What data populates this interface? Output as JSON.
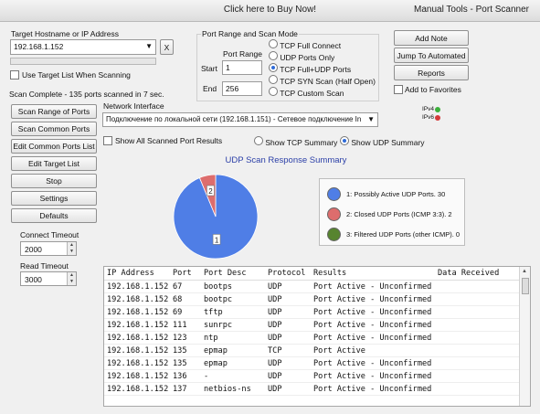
{
  "title": {
    "buy": "Click here to Buy Now!",
    "right": "Manual Tools - Port Scanner"
  },
  "target": {
    "label": "Target Hostname or IP Address",
    "value": "192.168.1.152",
    "clear_label": "X",
    "use_target_list_label": "Use Target List When Scanning"
  },
  "status_text": "Scan Complete - 135 ports scanned in 7 sec.",
  "port_range": {
    "group_label": "Port Range and Scan Mode",
    "section_label": "Port Range",
    "start_label": "Start",
    "start_value": "1",
    "end_label": "End",
    "end_value": "256"
  },
  "scan_modes": [
    {
      "label": "TCP Full Connect",
      "selected": false
    },
    {
      "label": "UDP Ports Only",
      "selected": false
    },
    {
      "label": "TCP Full+UDP Ports",
      "selected": true
    },
    {
      "label": "TCP SYN Scan (Half Open)",
      "selected": false
    },
    {
      "label": "TCP Custom Scan",
      "selected": false
    }
  ],
  "right_buttons": {
    "add_note": "Add Note",
    "jump": "Jump To Automated",
    "reports": "Reports",
    "favorites_label": "Add to Favorites"
  },
  "ip_status": {
    "ipv4": "IPv4",
    "ipv6": "IPv6",
    "ipv4_color": "#3bb03b",
    "ipv6_color": "#d43a3a"
  },
  "network": {
    "label": "Network Interface",
    "value": "Подключение по локальной сети (192.168.1.151) - Сетевое подключение In"
  },
  "filters": {
    "show_all": "Show All Scanned Port Results",
    "show_tcp": "Show TCP Summary",
    "show_udp": "Show UDP Summary"
  },
  "side_buttons": {
    "scan_range": "Scan Range of Ports",
    "scan_common": "Scan Common Ports",
    "edit_common": "Edit Common Ports List",
    "edit_target": "Edit Target List",
    "stop": "Stop",
    "settings": "Settings",
    "defaults": "Defaults"
  },
  "timeouts": {
    "connect_label": "Connect Timeout",
    "connect_value": "2000",
    "read_label": "Read Timeout",
    "read_value": "3000"
  },
  "chart_data": {
    "type": "pie",
    "title": "UDP Scan Response Summary",
    "slices": [
      {
        "label": "1",
        "value": 30,
        "color": "#4f7ee6"
      },
      {
        "label": "2",
        "value": 2,
        "color": "#dd6d6d"
      },
      {
        "label": "3",
        "value": 0,
        "color": "#57842f"
      }
    ],
    "legend": [
      {
        "number": "1",
        "text": "1: Possibly Active UDP Ports. 30",
        "color": "#4f7ee6"
      },
      {
        "number": "2",
        "text": "2: Closed UDP Ports (ICMP 3:3). 2",
        "color": "#dd6d6d"
      },
      {
        "number": "3",
        "text": "3: Filtered UDP Ports (other ICMP). 0",
        "color": "#57842f"
      }
    ]
  },
  "table": {
    "headers": [
      "IP Address",
      "Port",
      "Port Desc",
      "Protocol",
      "Results",
      "Data Received"
    ],
    "rows": [
      [
        "192.168.1.152",
        "67",
        "bootps",
        "UDP",
        "Port Active - Unconfirmed",
        ""
      ],
      [
        "192.168.1.152",
        "68",
        "bootpc",
        "UDP",
        "Port Active - Unconfirmed",
        ""
      ],
      [
        "192.168.1.152",
        "69",
        "tftp",
        "UDP",
        "Port Active - Unconfirmed",
        ""
      ],
      [
        "192.168.1.152",
        "111",
        "sunrpc",
        "UDP",
        "Port Active - Unconfirmed",
        ""
      ],
      [
        "192.168.1.152",
        "123",
        "ntp",
        "UDP",
        "Port Active - Unconfirmed",
        ""
      ],
      [
        "192.168.1.152",
        "135",
        "epmap",
        "TCP",
        "Port Active",
        ""
      ],
      [
        "192.168.1.152",
        "135",
        "epmap",
        "UDP",
        "Port Active - Unconfirmed",
        ""
      ],
      [
        "192.168.1.152",
        "136",
        "-",
        "UDP",
        "Port Active - Unconfirmed",
        ""
      ],
      [
        "192.168.1.152",
        "137",
        "netbios-ns",
        "UDP",
        "Port Active - Unconfirmed",
        ""
      ]
    ]
  }
}
